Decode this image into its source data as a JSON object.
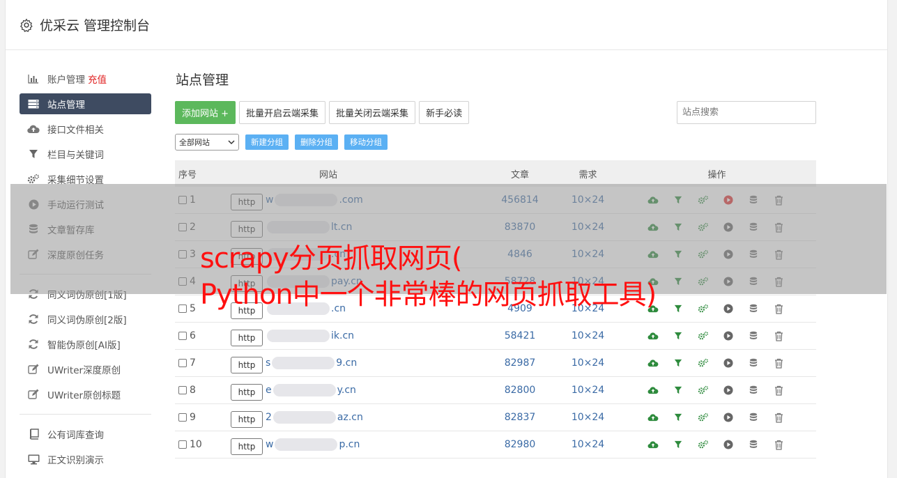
{
  "app": {
    "title": "优采云 管理控制台"
  },
  "sidebar": {
    "items": [
      {
        "label": "账户管理",
        "extra": "充值",
        "icon": "bar-chart-icon"
      },
      {
        "label": "站点管理",
        "icon": "server-icon",
        "active": true
      },
      {
        "label": "接口文件相关",
        "icon": "cloud-upload-icon"
      },
      {
        "label": "栏目与关键词",
        "icon": "filter-icon"
      },
      {
        "label": "采集细节设置",
        "icon": "gears-icon"
      },
      {
        "label": "手动运行测试",
        "icon": "play-icon"
      },
      {
        "label": "文章暂存库",
        "icon": "database-icon"
      },
      {
        "label": "深度原创任务",
        "icon": "edit-icon"
      }
    ],
    "items2": [
      {
        "label": "同义词伪原创[1版]",
        "icon": "refresh-icon"
      },
      {
        "label": "同义词伪原创[2版]",
        "icon": "refresh-icon"
      },
      {
        "label": "智能伪原创[AI版]",
        "icon": "refresh-icon"
      },
      {
        "label": "UWriter深度原创",
        "icon": "edit-icon"
      },
      {
        "label": "UWriter原创标题",
        "icon": "edit-icon"
      }
    ],
    "items3": [
      {
        "label": "公有词库查询",
        "icon": "book-icon"
      },
      {
        "label": "正文识别演示",
        "icon": "monitor-icon"
      }
    ]
  },
  "main": {
    "title": "站点管理",
    "add_btn": "添加网站 +",
    "batch_open": "批量开启云端采集",
    "batch_close": "批量关闭云端采集",
    "guide": "新手必读",
    "search_placeholder": "站点搜索",
    "select_value": "全部网站",
    "new_group": "新建分组",
    "del_group": "删除分组",
    "move_group": "移动分组"
  },
  "table": {
    "headers": {
      "no": "序号",
      "site": "网站",
      "count": "文章",
      "need": "需求",
      "ops": "操作"
    },
    "rows": [
      {
        "no": "1",
        "proto": "http",
        "pre": "w",
        "post": ".com",
        "count": "456814",
        "need": "10×24",
        "running": true
      },
      {
        "no": "2",
        "proto": "http",
        "pre": "",
        "post": "lt.cn",
        "count": "83870",
        "need": "10×24"
      },
      {
        "no": "3",
        "proto": "http",
        "pre": "",
        "post": ".cn",
        "count": "4846",
        "need": "10×24"
      },
      {
        "no": "4",
        "proto": "http",
        "pre": "",
        "post": "pay.cn",
        "count": "58728",
        "need": "10×24"
      },
      {
        "no": "5",
        "proto": "http",
        "pre": "",
        "post": ".cn",
        "count": "4909",
        "need": "10×24"
      },
      {
        "no": "6",
        "proto": "http",
        "pre": "",
        "post": "ik.cn",
        "count": "58421",
        "need": "10×24"
      },
      {
        "no": "7",
        "proto": "http",
        "pre": "s",
        "post": "9.cn",
        "count": "82987",
        "need": "10×24"
      },
      {
        "no": "8",
        "proto": "http",
        "pre": "e",
        "post": "y.cn",
        "count": "82800",
        "need": "10×24"
      },
      {
        "no": "9",
        "proto": "http",
        "pre": "2",
        "post": "az.cn",
        "count": "82837",
        "need": "10×24"
      },
      {
        "no": "10",
        "proto": "http",
        "pre": "w",
        "post": "p.cn",
        "count": "82980",
        "need": "10×24"
      }
    ]
  },
  "caption": {
    "line1": "scrapy分页抓取网页(",
    "line2": "Python中一个非常棒的网页抓取工具)"
  },
  "colors": {
    "accent_green": "#5cb85c",
    "sidebar_active": "#3e4b61",
    "link": "#3a6aa5",
    "caption_red": "#ff1010"
  }
}
